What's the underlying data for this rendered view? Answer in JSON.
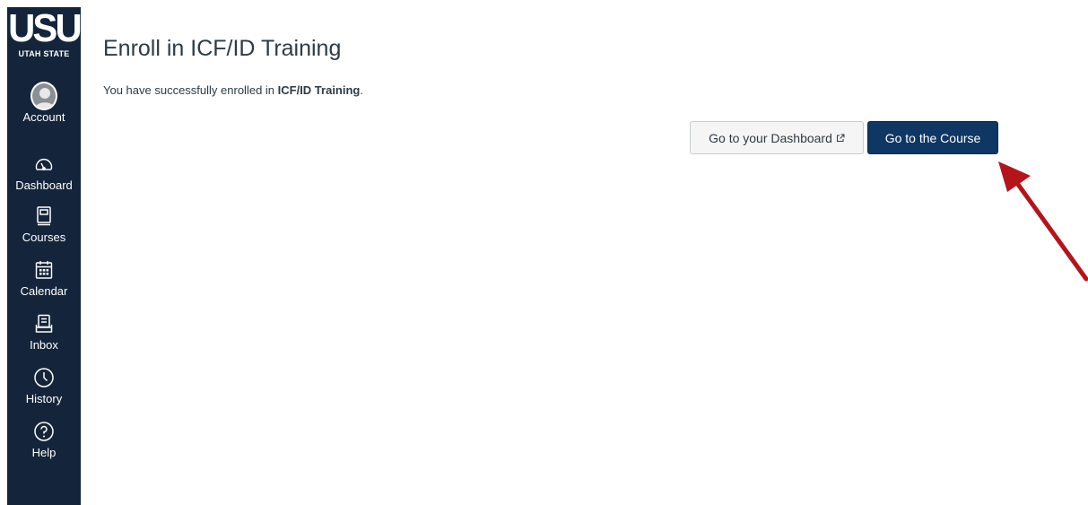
{
  "sidebar": {
    "logo": {
      "mark": "USU",
      "subtitle": "UTAH STATE"
    },
    "items": [
      {
        "label": "Account",
        "icon": "avatar-icon"
      },
      {
        "label": "Dashboard",
        "icon": "dashboard-icon"
      },
      {
        "label": "Courses",
        "icon": "courses-icon"
      },
      {
        "label": "Calendar",
        "icon": "calendar-icon"
      },
      {
        "label": "Inbox",
        "icon": "inbox-icon"
      },
      {
        "label": "History",
        "icon": "history-icon"
      },
      {
        "label": "Help",
        "icon": "help-icon"
      }
    ],
    "background_color": "#14253b"
  },
  "main": {
    "title": "Enroll in ICF/ID Training",
    "message_prefix": "You have successfully enrolled in ",
    "course_name": "ICF/ID Training",
    "message_suffix": ".",
    "dashboard_button": "Go to your Dashboard",
    "course_button": "Go to the Course"
  },
  "annotation": {
    "arrow_color": "#b3151b"
  },
  "colors": {
    "primary_button": "#0e3763",
    "text": "#2d3b45"
  }
}
